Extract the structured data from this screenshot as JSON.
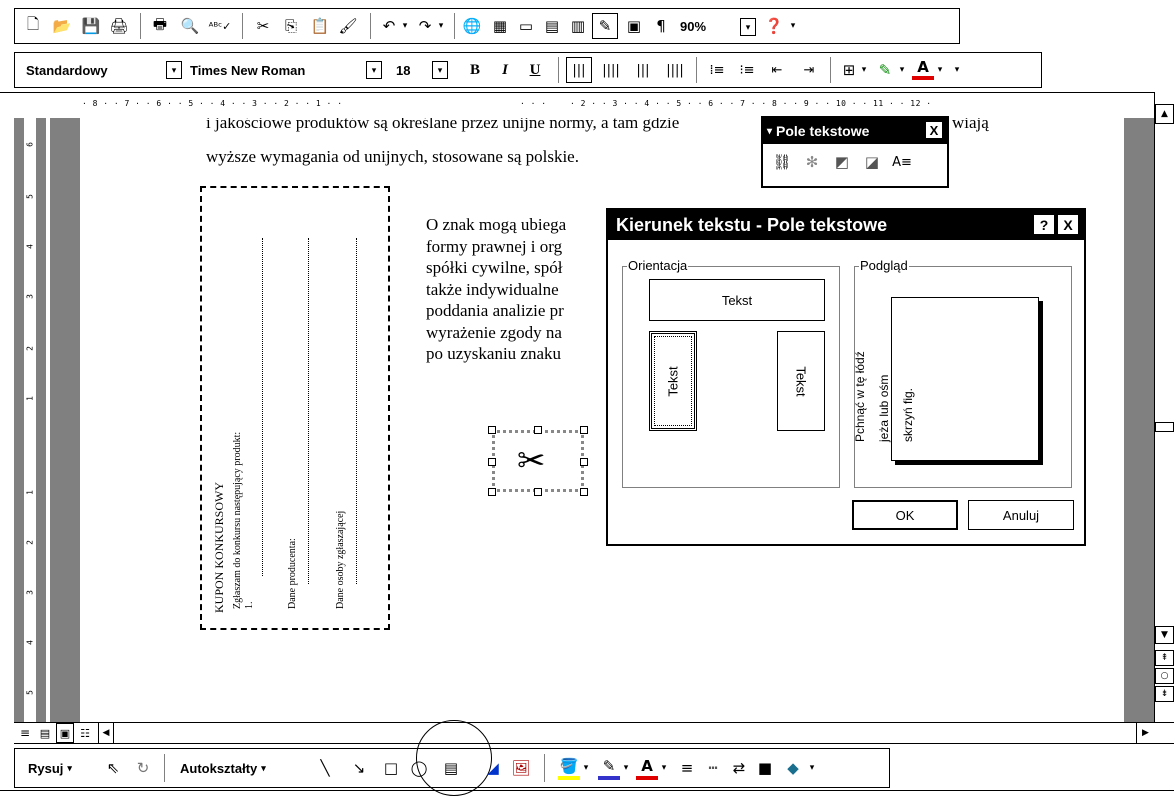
{
  "standard_toolbar": {
    "zoom": "90%",
    "icons": [
      "new-icon",
      "open-icon",
      "save-icon",
      "permissions-icon",
      "print-icon",
      "print-preview-icon",
      "spelling-icon",
      "cut-icon",
      "copy-icon",
      "paste-icon",
      "format-painter-icon",
      "undo-icon",
      "redo-icon",
      "hyperlink-icon",
      "tables-borders-icon",
      "insert-table-icon",
      "insert-excel-icon",
      "columns-icon",
      "drawing-icon",
      "document-map-icon",
      "show-hide-icon"
    ]
  },
  "formatting_toolbar": {
    "style": "Standardowy",
    "font": "Times New Roman",
    "size": "18",
    "bold": "B",
    "italic": "I",
    "underline": "U"
  },
  "ruler": {
    "top_left": "· 8 · · 7 · · 6 · · 5 · · 4 · · 3 · · 2 · · 1 · ·",
    "top_right": "· 2 · · 3 · · 4 · · 5 · · 6 · · 7 · · 8 · · 9 · · 10 · · 11 · · 12 ·"
  },
  "document": {
    "line1": "i jakościowe produktów są określane przez unijne normy, a tam gdzie",
    "line1_end": "wiają",
    "line2": "wyższe wymagania od unijnych, stosowane są polskie.",
    "para": [
      "O znak mogą ubiega",
      "formy prawnej i org",
      "spółki cywilne, spół",
      "także indywidualne",
      "poddania analizie pr",
      "wyrażenie zgody na",
      "po uzyskaniu znaku"
    ],
    "coupon": {
      "title": "KUPON KONKURSOWY",
      "line1": "Zgłaszam do konkursu następujący produkt:",
      "line1_num": "1.",
      "line2": "Dane producenta:",
      "line3": "Dane osoby zgłaszającej"
    }
  },
  "pole_toolbar": {
    "title": "Pole tekstowe",
    "close": "X"
  },
  "dialog": {
    "title": "Kierunek tekstu - Pole tekstowe",
    "help": "?",
    "close": "X",
    "orientation_label": "Orientacja",
    "horizontal_text": "Tekst",
    "vertical_up_text": "Tekst",
    "vertical_down_text": "Tekst",
    "preview_label": "Podgląd",
    "preview_lines": [
      "Pchnąć w tę łódź",
      "jeża lub ośm",
      "skrzyń fig."
    ],
    "ok": "OK",
    "cancel": "Anuluj"
  },
  "drawing_toolbar": {
    "draw": "Rysuj",
    "autoshapes": "Autokształty"
  }
}
